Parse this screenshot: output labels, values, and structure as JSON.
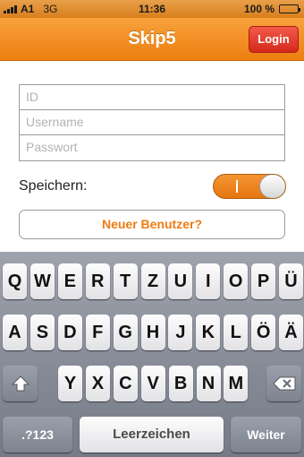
{
  "status_bar": {
    "carrier": "A1",
    "network": "3G",
    "time": "11:36",
    "battery_percent": "100 %",
    "battery_level": 1.0
  },
  "nav": {
    "title": "Skip5",
    "login_label": "Login"
  },
  "form": {
    "id_placeholder": "ID",
    "username_placeholder": "Username",
    "password_placeholder": "Passwort"
  },
  "save": {
    "label": "Speichern:",
    "toggle_on": true
  },
  "new_user_label": "Neuer Benutzer?",
  "keyboard": {
    "row1": [
      "Q",
      "W",
      "E",
      "R",
      "T",
      "Z",
      "U",
      "I",
      "O",
      "P",
      "Ü"
    ],
    "row2": [
      "A",
      "S",
      "D",
      "F",
      "G",
      "H",
      "J",
      "K",
      "L",
      "Ö",
      "Ä"
    ],
    "row3": [
      "Y",
      "X",
      "C",
      "V",
      "B",
      "N",
      "M"
    ],
    "numbers_label": ".?123",
    "space_label": "Leerzeichen",
    "return_label": "Weiter",
    "shift_icon": "shift-arrow-icon",
    "delete_icon": "backspace-icon"
  },
  "colors": {
    "accent": "#ef7b12",
    "login_red": "#d5291b"
  }
}
